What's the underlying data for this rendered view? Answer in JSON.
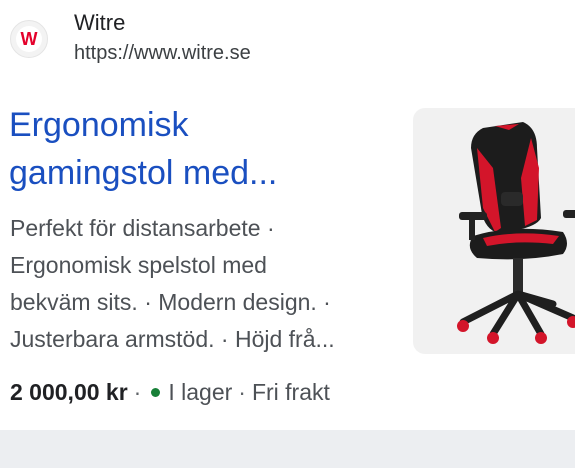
{
  "site": {
    "name": "Witre",
    "url": "https://www.witre.se",
    "favicon_icon": "witre-logo-icon",
    "brand_color": "#e4002b"
  },
  "result": {
    "title_line1": "Ergonomisk",
    "title_line2": "gamingstol med...",
    "snippet_lines": [
      "Perfekt för distansarbete ·",
      "Ergonomisk spelstol med",
      "bekväm sits. · Modern design. ·",
      "Justerbara armstöd. · Höjd frå..."
    ],
    "image_icon": "gaming-chair-image",
    "price": "2 000,00 kr",
    "separator": "·",
    "stock": "I lager",
    "shipping": "Fri frakt",
    "stock_color": "#188038",
    "link_color": "#1a4fc0"
  }
}
